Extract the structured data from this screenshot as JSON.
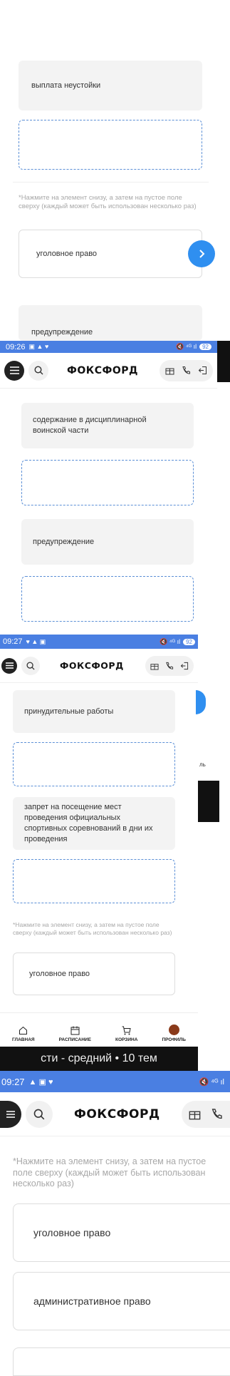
{
  "section1": {
    "card_top": "выплата неустойки",
    "hint": "*Нажмите на элемент снизу, а затем на пустое поле сверху (каждый может быть использован несколько раз)",
    "answer": "уголовное право",
    "card_bottom": "предупреждение"
  },
  "bar1": {
    "time": "09:26",
    "battery": "92"
  },
  "header": {
    "logo": "ФОКСФОРД"
  },
  "section2": {
    "card1": "содержание в дисциплинарной воинской части",
    "card2": "предупреждение"
  },
  "bar2": {
    "time": "09:27",
    "battery": "92"
  },
  "section3": {
    "card1": "принудительные работы",
    "card2": "запрет на посещение мест проведения официальных спортивных соревнований в дни их проведения",
    "hint": "*Нажмите на элемент снизу, а затем на пустое поле сверху (каждый может быть использован несколько раз)",
    "answer": "уголовное право",
    "side_text": "ль"
  },
  "nav": {
    "items": [
      {
        "label": "ГЛАВНАЯ",
        "icon": "home-icon"
      },
      {
        "label": "РАСПИСАНИЕ",
        "icon": "calendar-icon"
      },
      {
        "label": "КОРЗИНА",
        "icon": "cart-icon"
      },
      {
        "label": "ПРОФИЛЬ",
        "icon": "avatar"
      }
    ],
    "banner": "сти - средний • 10 тем"
  },
  "bar3": {
    "time": "09:27"
  },
  "section4": {
    "hint": "*Нажмите на элемент снизу, а затем на пустое поле сверху (каждый может быть использован несколько раз)",
    "answer1": "уголовное право",
    "answer2": "административное право"
  },
  "colors": {
    "accent": "#4a7fe2",
    "next_button": "#2f8ff0",
    "dashed": "#5b8fd6"
  }
}
